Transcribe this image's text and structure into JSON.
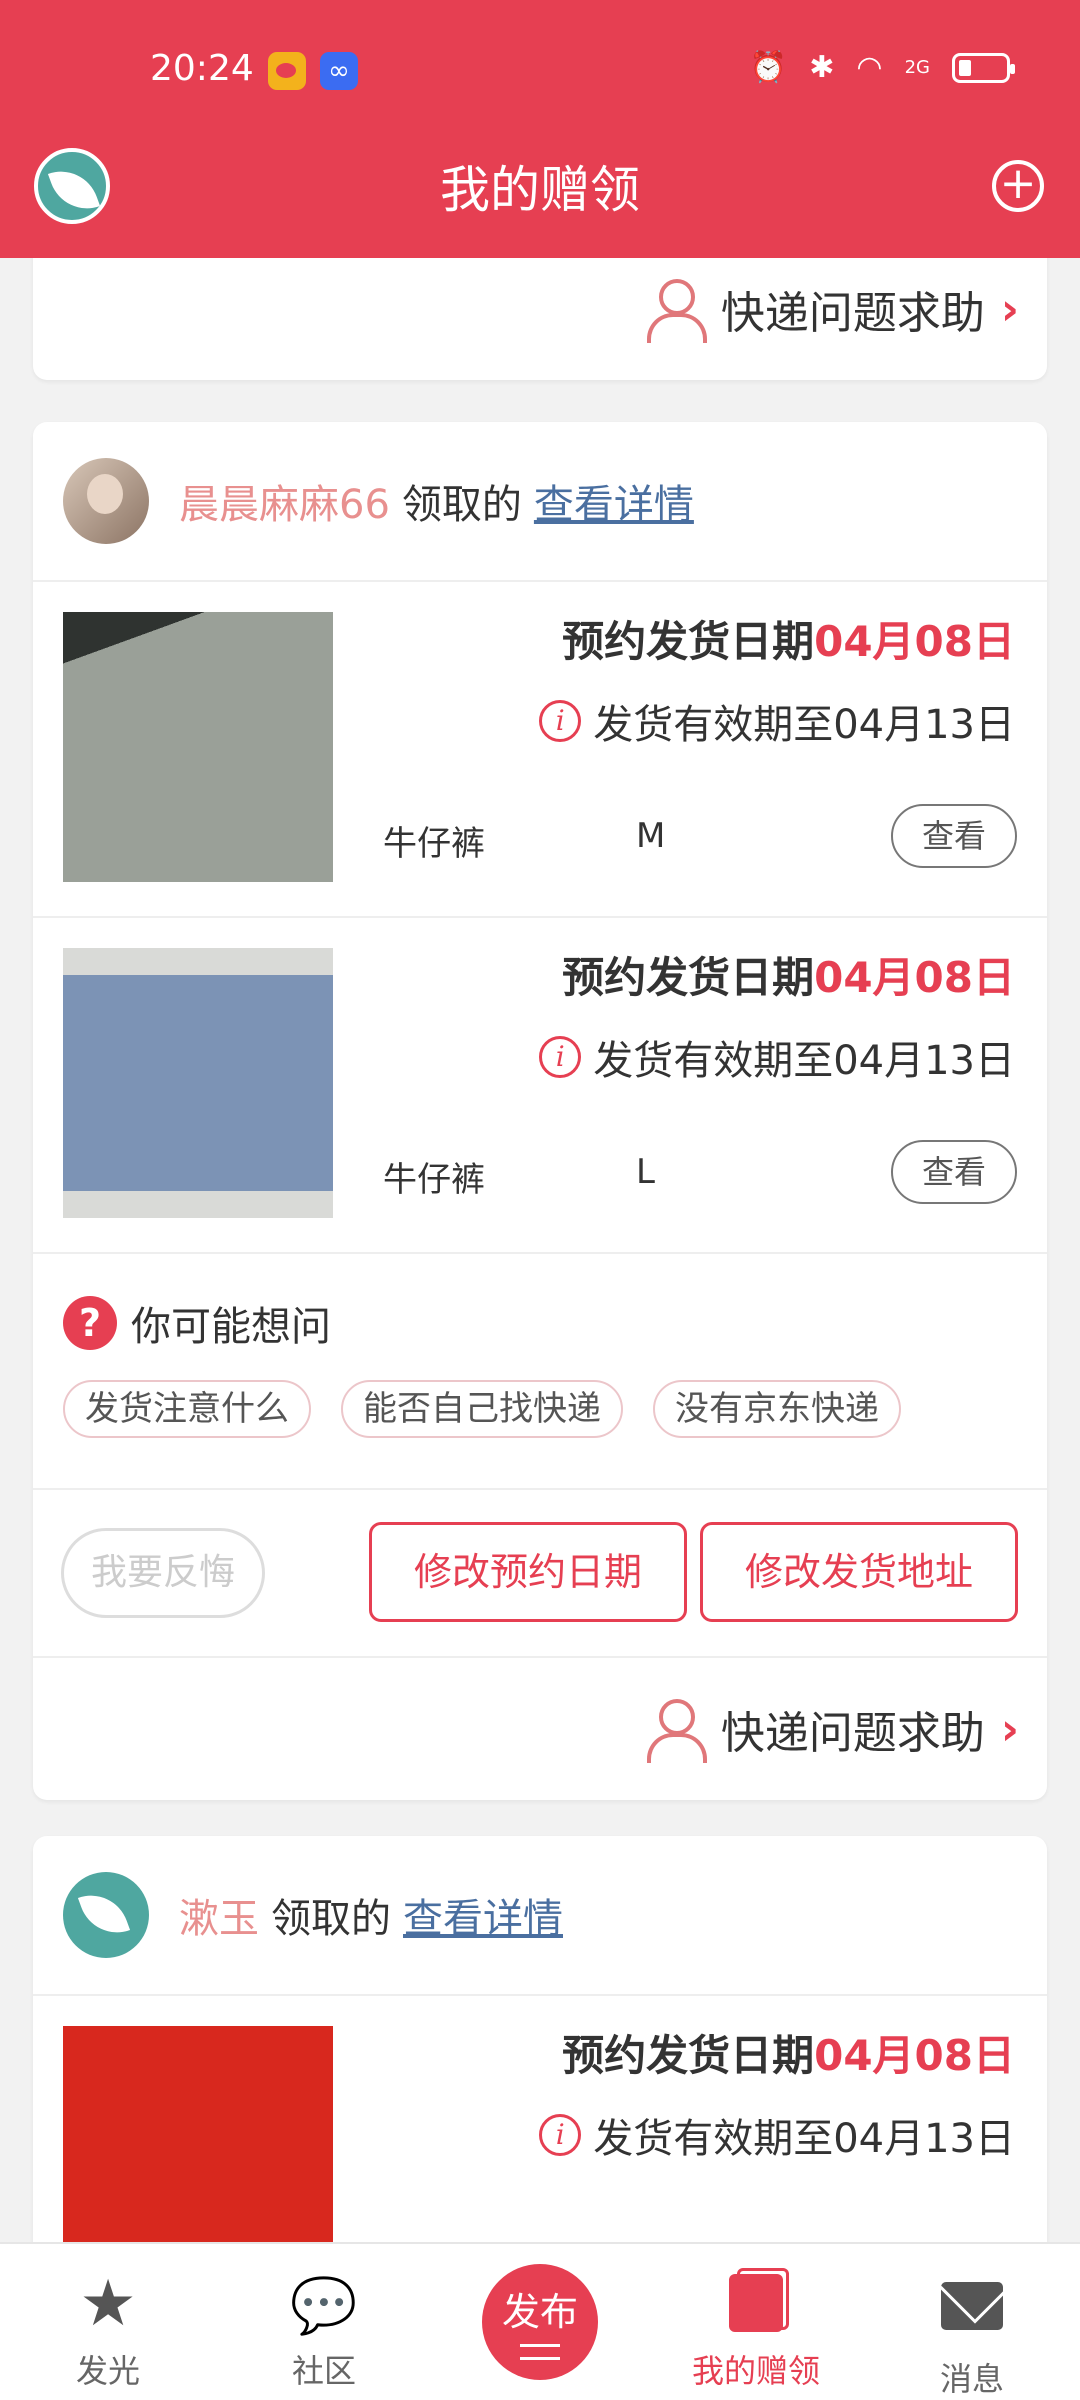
{
  "status_bar": {
    "time": "20:24",
    "network": "2G"
  },
  "header": {
    "title": "我的赠领"
  },
  "help_row": {
    "label": "快递问题求助"
  },
  "cards": [
    {
      "user": "晨晨麻麻66",
      "claim_label": "领取的",
      "detail_link": "查看详情",
      "items": [
        {
          "date_prefix": "预约发货日期",
          "date": "04月08日",
          "valid": "发货有效期至04月13日",
          "name": "牛仔裤",
          "size": "M",
          "view": "查看"
        },
        {
          "date_prefix": "预约发货日期",
          "date": "04月08日",
          "valid": "发货有效期至04月13日",
          "name": "牛仔裤",
          "size": "L",
          "view": "查看"
        }
      ],
      "faq": {
        "title": "你可能想问",
        "chips": [
          "发货注意什么",
          "能否自己找快递",
          "没有京东快递"
        ]
      },
      "actions": {
        "regret": "我要反悔",
        "change_date": "修改预约日期",
        "change_address": "修改发货地址"
      },
      "help": "快递问题求助"
    },
    {
      "user": "漱玉",
      "claim_label": "领取的",
      "detail_link": "查看详情",
      "items": [
        {
          "date_prefix": "预约发货日期",
          "date": "04月08日",
          "valid": "发货有效期至04月13日"
        }
      ]
    }
  ],
  "bottom_nav": {
    "glow": "发光",
    "community": "社区",
    "publish": "发布",
    "my_gifts": "我的赠领",
    "messages": "消息"
  },
  "colors": {
    "brand": "#e63f52",
    "username": "#e8908f",
    "link": "#4a6fa0"
  }
}
